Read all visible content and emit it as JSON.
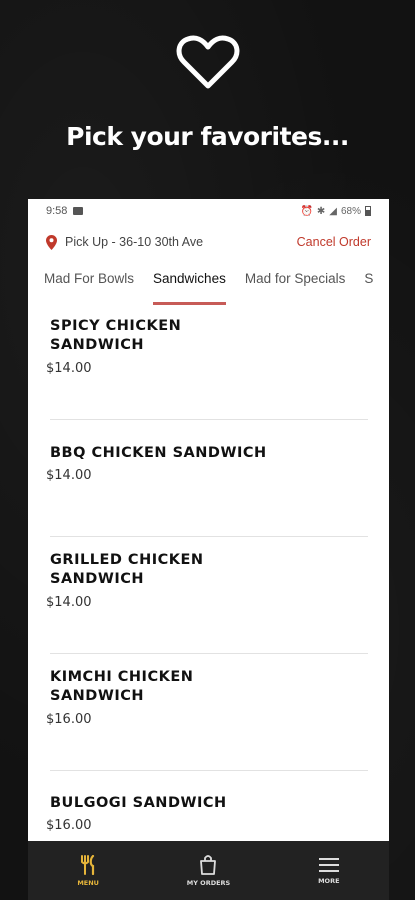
{
  "promo": {
    "icon": "heart-outline-icon",
    "title": "Pick your favorites..."
  },
  "status_bar": {
    "time": "9:58",
    "battery": "68%"
  },
  "pickup": {
    "label": "Pick Up - 36-10 30th Ave",
    "cancel_label": "Cancel Order"
  },
  "tabs": [
    {
      "label": "Mad For Bowls",
      "active": false
    },
    {
      "label": "Sandwiches",
      "active": true
    },
    {
      "label": "Mad for Specials",
      "active": false
    },
    {
      "label": "S",
      "active": false
    }
  ],
  "menu_items": [
    {
      "name": "SPICY CHICKEN SANDWICH",
      "price": "$14.00"
    },
    {
      "name": "BBQ CHICKEN SANDWICH",
      "price": "$14.00"
    },
    {
      "name": "GRILLED CHICKEN SANDWICH",
      "price": "$14.00"
    },
    {
      "name": "KIMCHI CHICKEN SANDWICH",
      "price": "$16.00"
    },
    {
      "name": "BULGOGI SANDWICH",
      "price": "$16.00"
    }
  ],
  "bottom_nav": [
    {
      "label": "MENU",
      "icon": "fork-knife-icon",
      "active": true
    },
    {
      "label": "MY ORDERS",
      "icon": "shopping-bag-icon",
      "active": false
    },
    {
      "label": "MORE",
      "icon": "hamburger-menu-icon",
      "active": false
    }
  ],
  "colors": {
    "accent_red": "#c75b57",
    "cancel_red": "#c0392b",
    "nav_active": "#e6b53a",
    "nav_bg": "#222222"
  }
}
